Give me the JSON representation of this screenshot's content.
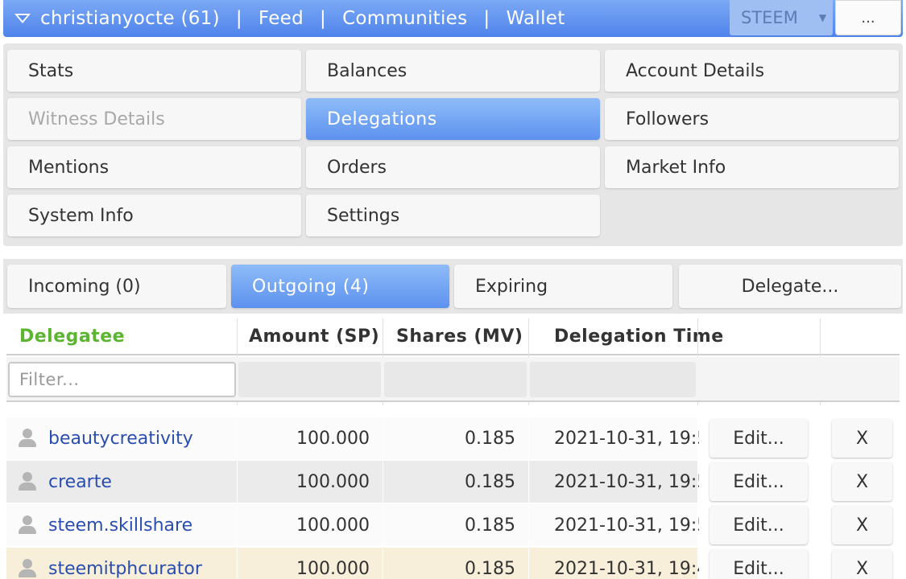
{
  "topbar": {
    "account": "christianyocte (61)",
    "nav": [
      "Feed",
      "Communities",
      "Wallet"
    ],
    "separator": "|",
    "chain": "STEEM",
    "more": "..."
  },
  "menu": {
    "stats": "Stats",
    "balances": "Balances",
    "account_details": "Account Details",
    "witness_details": "Witness Details",
    "delegations": "Delegations",
    "followers": "Followers",
    "mentions": "Mentions",
    "orders": "Orders",
    "market_info": "Market Info",
    "system_info": "System Info",
    "settings": "Settings"
  },
  "tabs": {
    "incoming": "Incoming (0)",
    "outgoing": "Outgoing (4)",
    "expiring": "Expiring",
    "delegate": "Delegate..."
  },
  "table": {
    "headers": {
      "delegatee": "Delegatee",
      "amount": "Amount (SP)",
      "shares": "Shares (MV)",
      "time": "Delegation Time"
    },
    "filter_placeholder": "Filter...",
    "edit_label": "Edit...",
    "remove_label": "X",
    "rows": [
      {
        "delegatee": "beautycreativity",
        "amount": "100.000",
        "shares": "0.185",
        "time": "2021-10-31, 19:5"
      },
      {
        "delegatee": "crearte",
        "amount": "100.000",
        "shares": "0.185",
        "time": "2021-10-31, 19:5"
      },
      {
        "delegatee": "steem.skillshare",
        "amount": "100.000",
        "shares": "0.185",
        "time": "2021-10-31, 19:5"
      },
      {
        "delegatee": "steemitphcurator",
        "amount": "100.000",
        "shares": "0.185",
        "time": "2021-10-31, 19:4"
      }
    ]
  },
  "colors": {
    "accent": "#5d91ef",
    "delegatee_header": "#5cb531",
    "link": "#2a4db0",
    "highlight_row": "#f7efd9"
  }
}
